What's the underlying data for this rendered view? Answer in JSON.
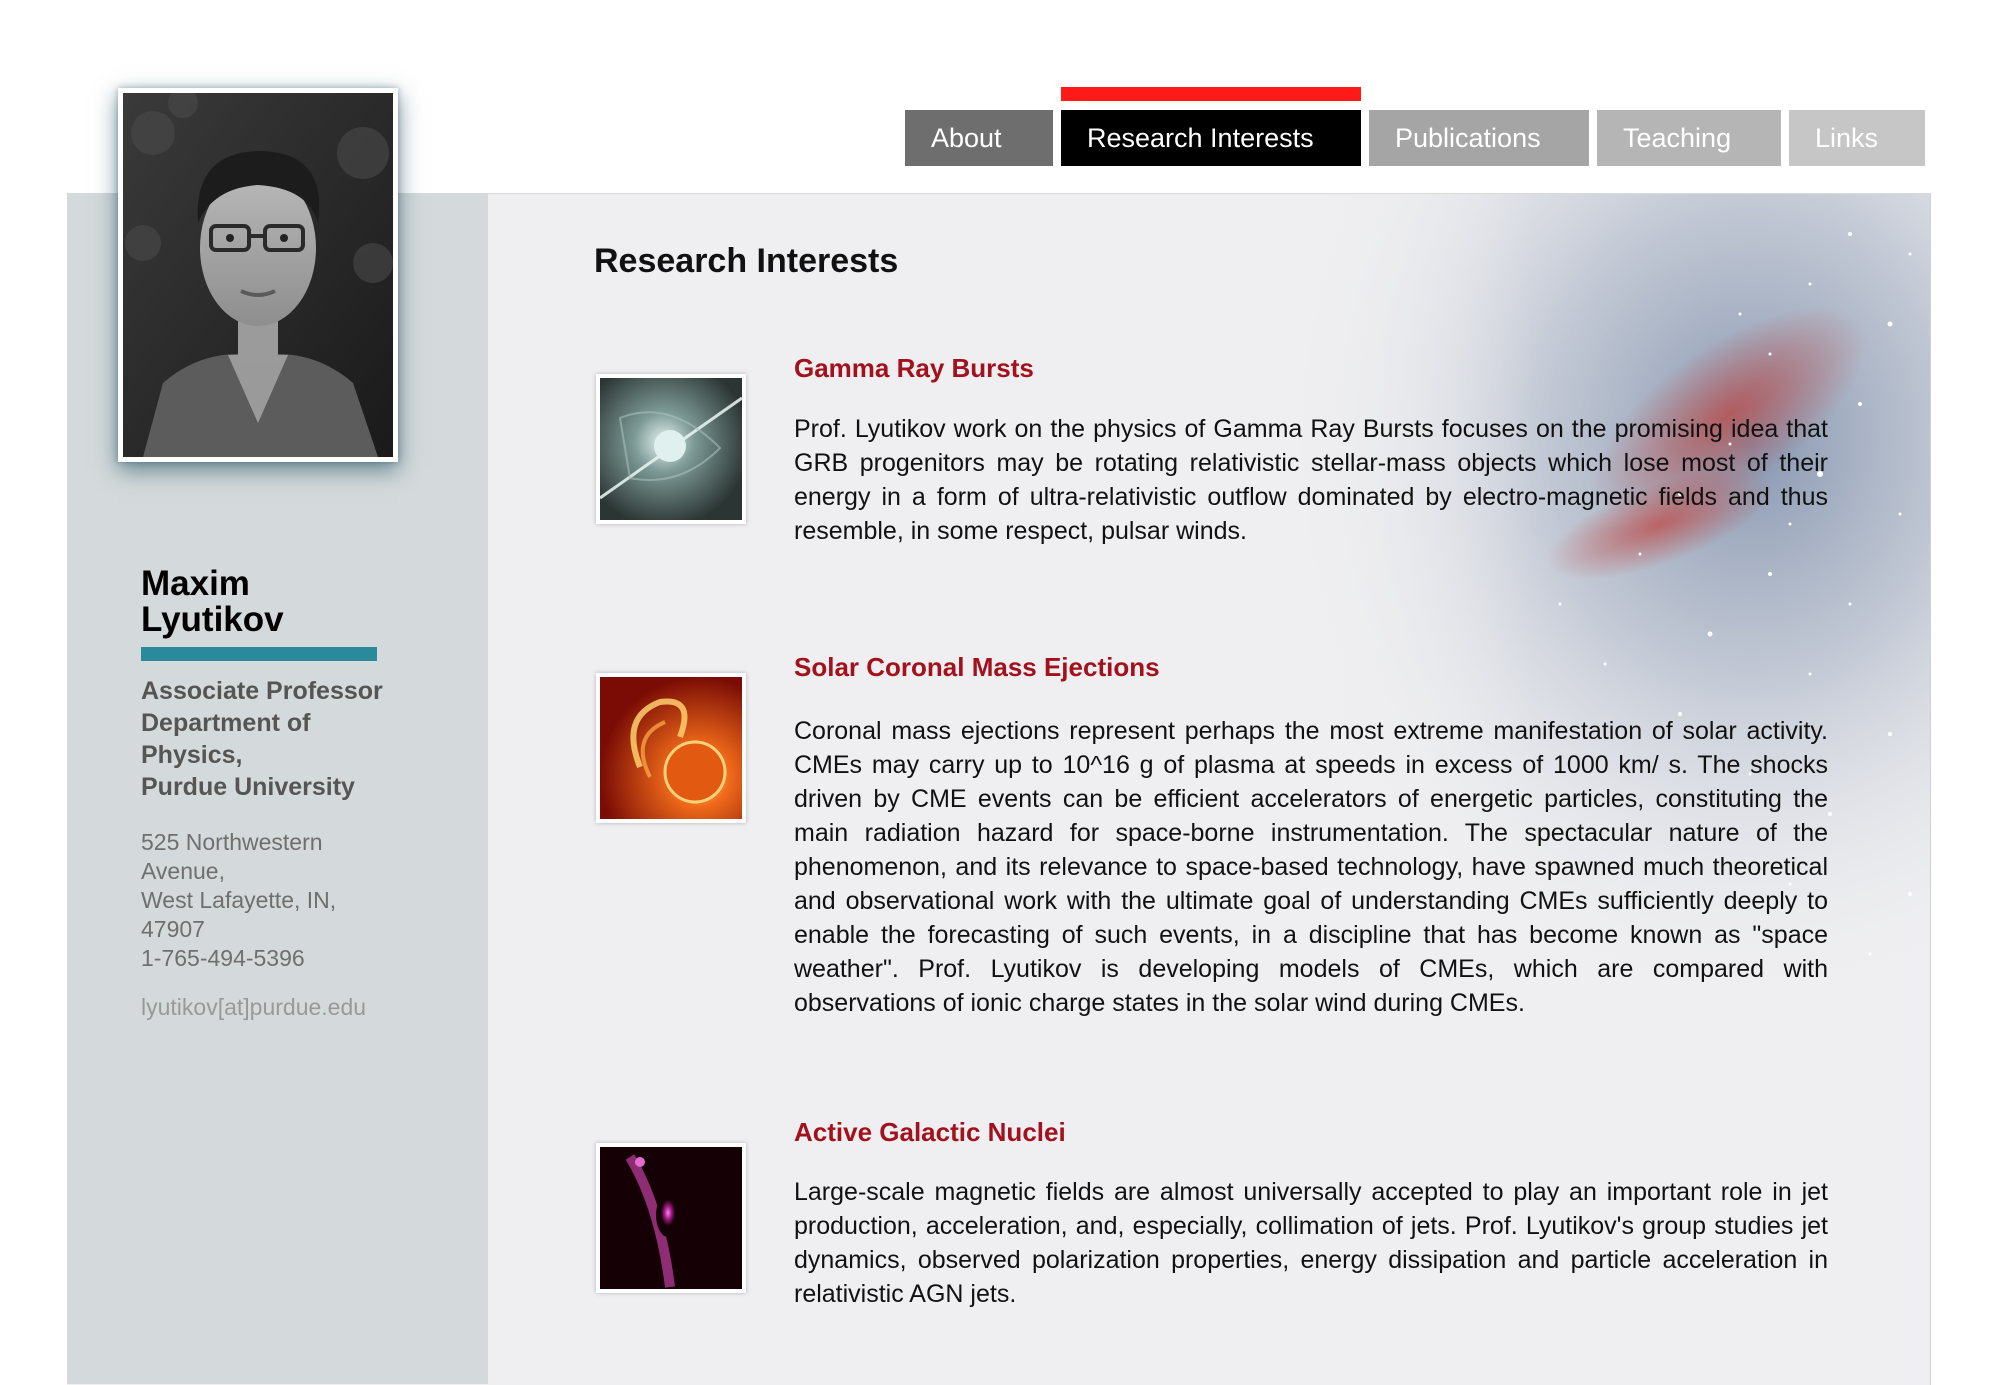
{
  "nav": {
    "about": "About",
    "research": "Research Interests",
    "publications": "Publications",
    "teaching": "Teaching",
    "links": "Links"
  },
  "profile": {
    "first_name": "Maxim",
    "last_name": "Lyutikov",
    "title_lines": [
      "Associate Professor",
      "Department of",
      "Physics,",
      "Purdue University"
    ],
    "address_lines": [
      "525 Northwestern",
      "Avenue,",
      "West Lafayette, IN,",
      "47907",
      "1-765-494-5396"
    ],
    "email": "lyutikov[at]purdue.edu"
  },
  "page_title": "Research Interests",
  "sections": [
    {
      "title": "Gamma Ray Bursts",
      "body": "Prof. Lyutikov work on the physics of Gamma Ray Bursts focuses on the promising idea that GRB progenitors may be rotating relativistic stellar-mass objects which lose most of their energy in a form of ultra-relativistic outflow dominated by electro-magnetic fields and thus resemble, in some respect, pulsar winds."
    },
    {
      "title": "Solar Coronal Mass Ejections",
      "body": "Coronal mass ejections represent perhaps the most extreme manifestation of solar activity. CMEs may carry up to 10^16 g of plasma at speeds in excess of 1000 km/ s. The shocks driven by CME events can be efficient accelerators of energetic particles, constituting the main radiation hazard for space-borne instrumentation. The spectacular nature of the phenomenon, and its relevance to space-based technology, have spawned much theoretical and observational work with the ultimate goal of understanding CMEs sufficiently deeply to enable the forecasting of such events, in a discipline that has become known as \"space weather\". Prof. Lyutikov is developing models of CMEs, which are compared with observations of ionic charge states in the solar wind during CMEs."
    },
    {
      "title": "Active Galactic Nuclei",
      "body": "Large-scale magnetic fields are almost universally accepted to play an important role in jet production, acceleration, and, especially, collimation of jets. Prof. Lyutikov's group studies jet dynamics, observed polarization properties, energy dissipation and particle acceleration in relativistic AGN jets."
    }
  ],
  "colors": {
    "accent_red": "#ff1a1a",
    "heading_red": "#a2111c",
    "name_bar": "#2a8a9c",
    "sidebar": "#d4dadb",
    "panel": "#efeff1"
  }
}
